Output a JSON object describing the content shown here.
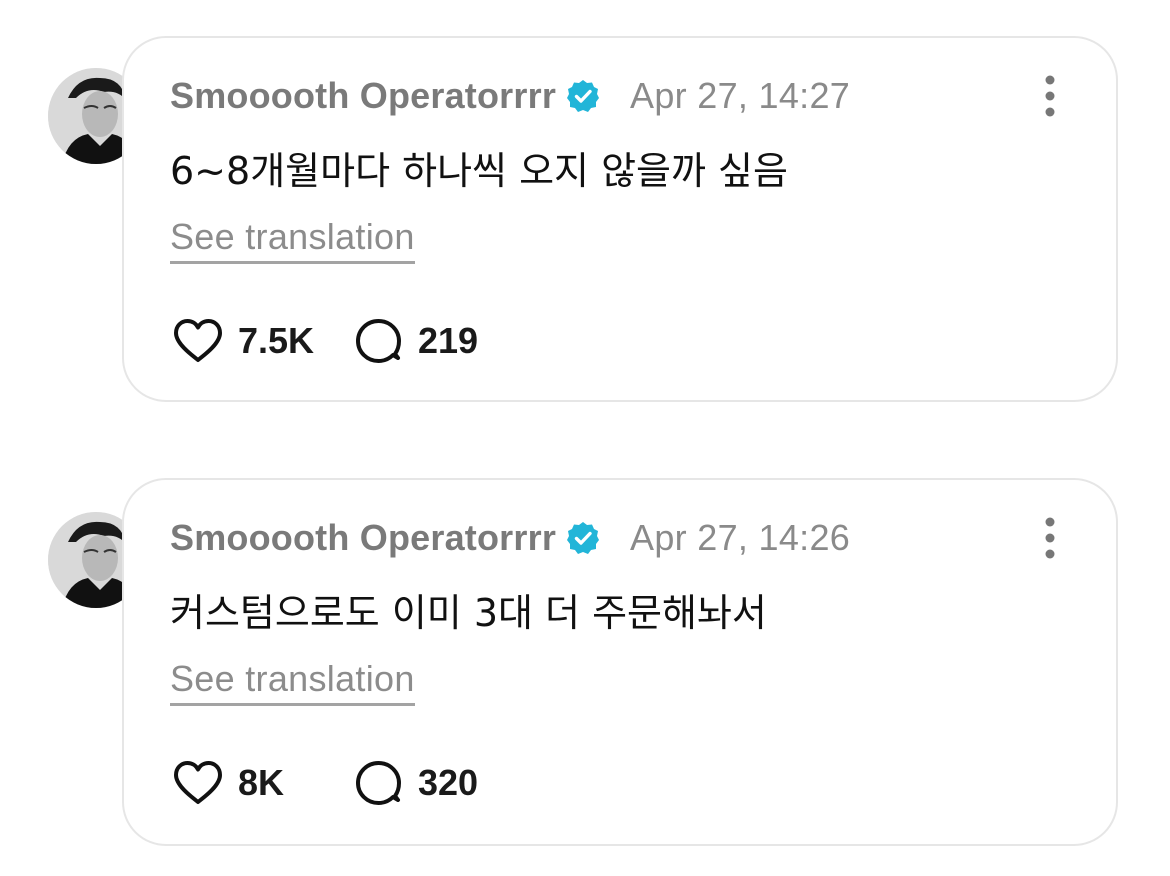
{
  "posts": [
    {
      "username": "Smooooth Operatorrrr",
      "timestamp": "Apr 27, 14:27",
      "text": "6~8개월마다 하나씩 오지 않을까 싶음",
      "translation_link": "See translation",
      "likes": "7.5K",
      "replies": "219"
    },
    {
      "username": "Smooooth Operatorrrr",
      "timestamp": "Apr 27, 14:26",
      "text": "커스텀으로도 이미 3대 더 주문해놔서",
      "translation_link": "See translation",
      "likes": "8K",
      "replies": "320"
    }
  ],
  "icons": {
    "verified": "verified-badge-icon",
    "more": "more-vertical-icon",
    "like": "heart-icon",
    "reply": "comment-bubble-icon"
  },
  "colors": {
    "verified_badge": "#22b5d8",
    "card_border": "#e6e6e6",
    "muted_text": "#7a7a7a"
  }
}
